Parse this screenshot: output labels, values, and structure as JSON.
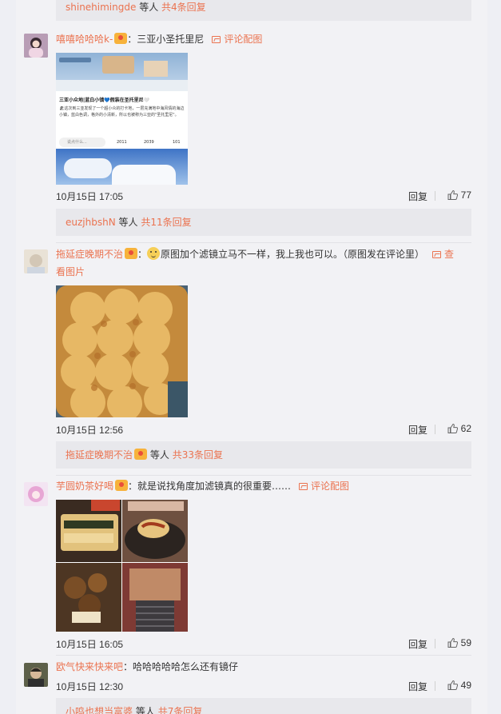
{
  "top_sub": {
    "user": "shinehimingde",
    "middle": "等人",
    "total": "共4条回复"
  },
  "comments": [
    {
      "user": "嘻嘻哈哈哈k-",
      "colon": "：",
      "text": "三亚小圣托里尼",
      "img_link": "评论配图",
      "time": "10月15日 17:05",
      "reply": "回复",
      "likes": "77",
      "screenshot": {
        "title": "三亚小众地|蓝白小镇💙假装在圣托里尼🤍",
        "body": "🏖这次到三亚发现了一个超小众的打卡地，一层充满地中海风情的海边小镇，蓝白色调，格外的小清新，所以也被称为三亚的\"圣托里尼\"。",
        "input_placeholder": "说点什么...",
        "stat1": "2011",
        "stat2": "2039",
        "stat3": "101"
      },
      "sub": {
        "user": "euzjhbshN",
        "middle": "等人",
        "total": "共11条回复"
      }
    },
    {
      "user": "拖延症晚期不治",
      "colon": "：",
      "text": "原图加个滤镜立马不一样，我上我也可以。（原图发在评论里）",
      "img_link_line1": "查",
      "img_link_line2": "看图片",
      "time": "10月15日 12:56",
      "reply": "回复",
      "likes": "62",
      "sub": {
        "user": "拖延症晚期不治",
        "middle": "等人",
        "total": "共33条回复"
      }
    },
    {
      "user": "芋圆奶茶好喝",
      "colon": "：",
      "text": "就是说找角度加滤镜真的很重要……",
      "img_link": "评论配图",
      "time": "10月15日 16:05",
      "reply": "回复",
      "likes": "59"
    },
    {
      "user": "欧气快来快来吧",
      "colon": "：",
      "text": "哈哈哈哈哈怎么还有镜仔",
      "time": "10月15日 12:30",
      "reply": "回复",
      "likes": "49",
      "sub": {
        "user": "小鸣也想当富婆",
        "middle": "等人",
        "total": "共7条回复"
      }
    }
  ],
  "colors": {
    "link": "#eb7350",
    "panel": "#f2f2f5",
    "subbar": "#e8e8ec"
  },
  "icons": [
    "image-icon",
    "thumbs-up-icon",
    "vip-badge-icon",
    "smiley-icon"
  ]
}
